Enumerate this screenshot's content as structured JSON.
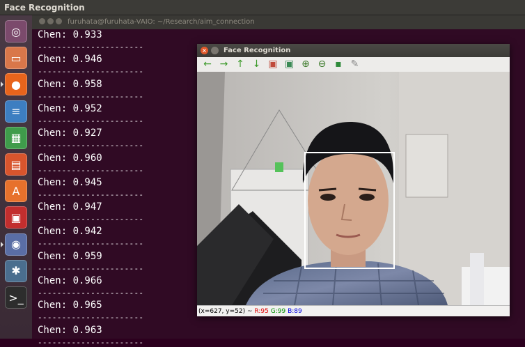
{
  "top_bar": {
    "title": "Face Recognition"
  },
  "launcher": {
    "items": [
      {
        "icon": "dash-icon",
        "glyph": "◎",
        "color": "#7b4a6c"
      },
      {
        "icon": "files-icon",
        "glyph": "▭",
        "color": "#d9774a"
      },
      {
        "icon": "firefox-icon",
        "glyph": "●",
        "color": "#e8641c"
      },
      {
        "icon": "writer-icon",
        "glyph": "≡",
        "color": "#3d7ec1"
      },
      {
        "icon": "calc-icon",
        "glyph": "▦",
        "color": "#3f9c4b"
      },
      {
        "icon": "impress-icon",
        "glyph": "▤",
        "color": "#d8552d"
      },
      {
        "icon": "software-center-icon",
        "glyph": "A",
        "color": "#e7712c"
      },
      {
        "icon": "face-app-icon",
        "glyph": "▣",
        "color": "#c22e2e"
      },
      {
        "icon": "system-settings-icon",
        "glyph": "◉",
        "color": "#5a6ea5"
      },
      {
        "icon": "tools-icon",
        "glyph": "✱",
        "color": "#4a6e8e"
      },
      {
        "icon": "terminal-icon",
        "glyph": ">_",
        "color": "#2d2d2d"
      }
    ]
  },
  "terminal": {
    "title": "furuhata@furuhata-VAIO: ~/Research/aim_connection",
    "separator": "----------------------",
    "lines": [
      "Chen: 0.933",
      "Chen: 0.946",
      "Chen: 0.958",
      "Chen: 0.952",
      "Chen: 0.927",
      "Chen: 0.960",
      "Chen: 0.945",
      "Chen: 0.947",
      "Chen: 0.942",
      "Chen: 0.959",
      "Chen: 0.966",
      "Chen: 0.965",
      "Chen: 0.963"
    ]
  },
  "viewer": {
    "title": "Face Recognition",
    "toolbar": [
      {
        "name": "pan-left-button",
        "icon": "arrow-left-icon",
        "glyph": "←",
        "color": "#3c9a2a"
      },
      {
        "name": "pan-right-button",
        "icon": "arrow-right-icon",
        "glyph": "→",
        "color": "#3c9a2a"
      },
      {
        "name": "pan-up-button",
        "icon": "arrow-up-icon",
        "glyph": "↑",
        "color": "#3c9a2a"
      },
      {
        "name": "pan-down-button",
        "icon": "arrow-down-icon",
        "glyph": "↓",
        "color": "#3c9a2a"
      },
      {
        "name": "zoom-fit-button",
        "icon": "image-icon",
        "glyph": "▣",
        "color": "#c04a3a"
      },
      {
        "name": "zoom-original-button",
        "icon": "image-zoom-icon",
        "glyph": "▣",
        "color": "#3a8a55"
      },
      {
        "name": "zoom-in-button",
        "icon": "zoom-in-icon",
        "glyph": "⊕",
        "color": "#3c7a2a"
      },
      {
        "name": "zoom-out-button",
        "icon": "zoom-out-icon",
        "glyph": "⊖",
        "color": "#3c7a2a"
      },
      {
        "name": "save-button",
        "icon": "save-icon",
        "glyph": "▪",
        "color": "#2f8a3a"
      },
      {
        "name": "properties-button",
        "icon": "brush-icon",
        "glyph": "✎",
        "color": "#8a8a8a"
      }
    ],
    "status": {
      "coords": "(x=627, y=52) ~",
      "r": "R:95",
      "g": "G:99",
      "b": "B:89",
      "colors": {
        "r": "#e00000",
        "g": "#009000",
        "b": "#0000e0"
      }
    }
  }
}
